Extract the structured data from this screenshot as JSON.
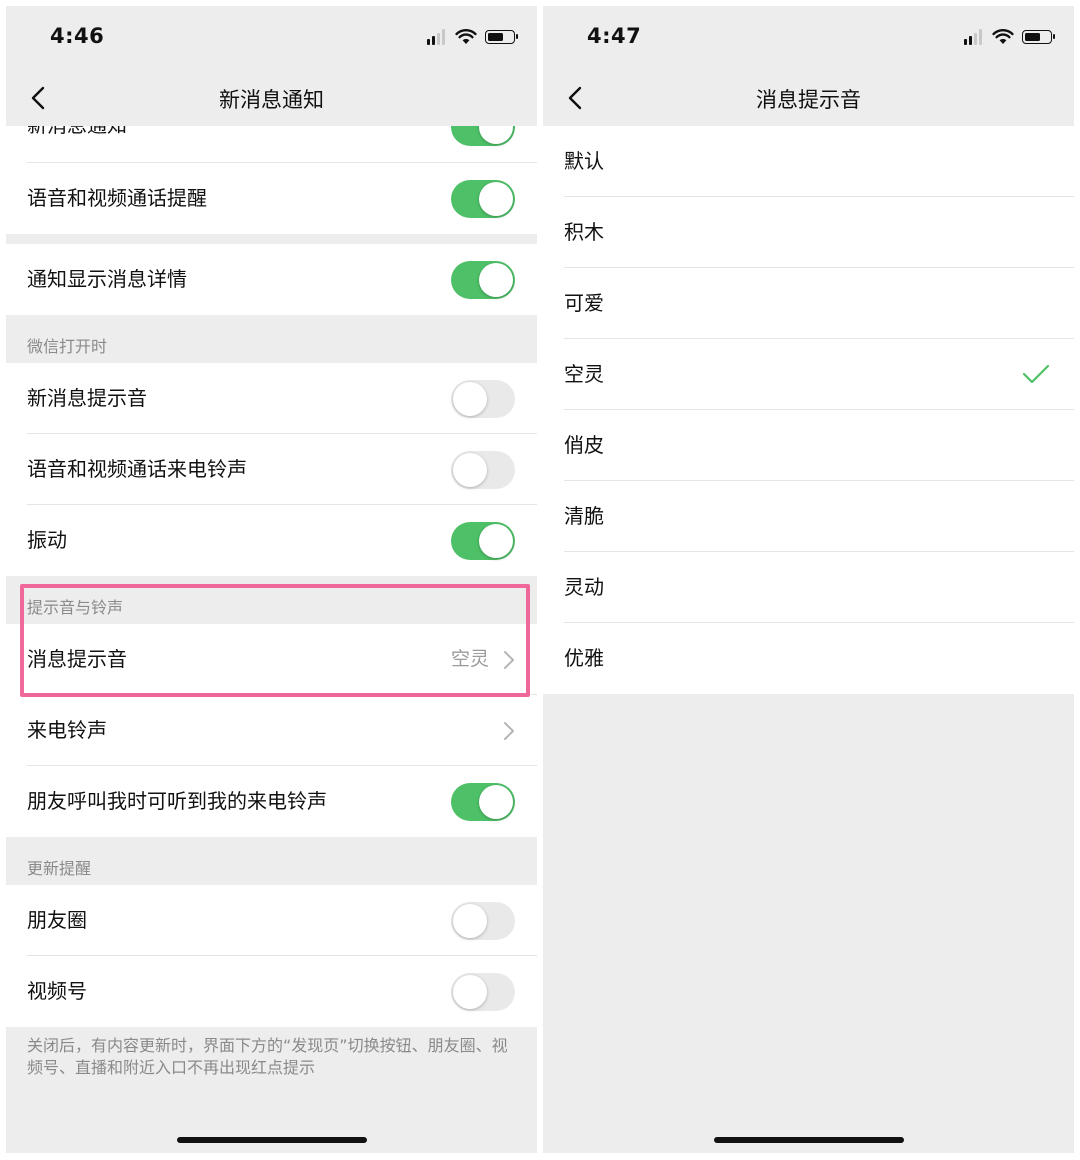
{
  "left": {
    "time": "4:46",
    "title": "新消息通知",
    "rows_top": [
      {
        "label": "新消息通知",
        "toggle": "on",
        "partial": true
      },
      {
        "label": "语音和视频通话提醒",
        "toggle": "on"
      }
    ],
    "row_details": {
      "label": "通知显示消息详情",
      "toggle": "on"
    },
    "section_open": {
      "header": "微信打开时",
      "rows": [
        {
          "label": "新消息提示音",
          "toggle": "off"
        },
        {
          "label": "语音和视频通话来电铃声",
          "toggle": "off"
        },
        {
          "label": "振动",
          "toggle": "on"
        }
      ]
    },
    "section_sound": {
      "header": "提示音与铃声",
      "message_tone": {
        "label": "消息提示音",
        "value": "空灵"
      },
      "ringtone": {
        "label": "来电铃声"
      },
      "friend_ring": {
        "label": "朋友呼叫我时可听到我的来电铃声",
        "toggle": "on"
      }
    },
    "section_update": {
      "header": "更新提醒",
      "rows": [
        {
          "label": "朋友圈",
          "toggle": "off"
        },
        {
          "label": "视频号",
          "toggle": "off"
        }
      ],
      "note": "关闭后，有内容更新时，界面下方的“发现页”切换按钮、朋友圈、视频号、直播和附近入口不再出现红点提示"
    }
  },
  "right": {
    "time": "4:47",
    "title": "消息提示音",
    "tones": [
      "默认",
      "积木",
      "可爱",
      "空灵",
      "俏皮",
      "清脆",
      "灵动",
      "优雅"
    ],
    "selected_index": 3
  },
  "colors": {
    "toggle_on": "#4ec168",
    "check": "#4ec168",
    "highlight": "#f0679a"
  }
}
